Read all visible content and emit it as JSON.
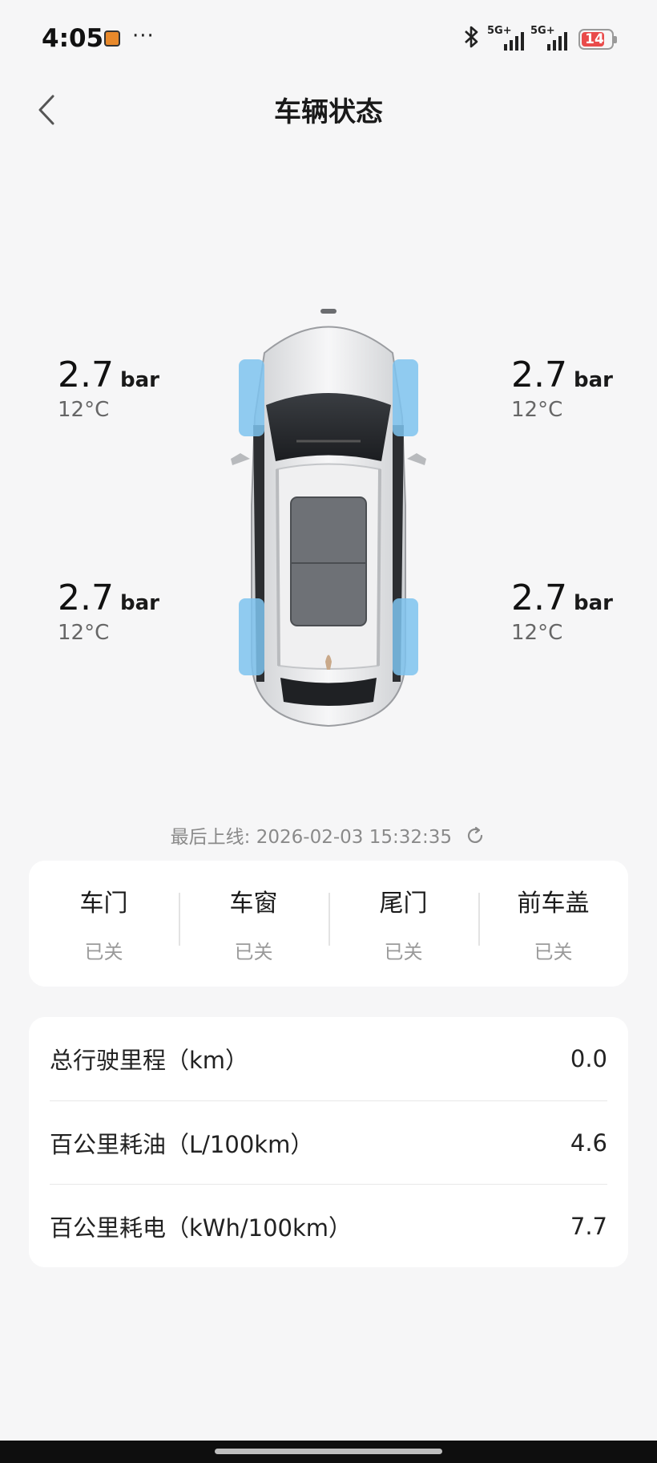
{
  "status_bar": {
    "time": "4:05",
    "dots": "···",
    "signal1": "5G+",
    "signal2": "5G+",
    "battery": "14",
    "icons": [
      "app-notification-icon",
      "bluetooth-icon",
      "signal-icon",
      "battery-icon"
    ]
  },
  "header": {
    "title": "车辆状态",
    "back_icon": "chevron-left-icon"
  },
  "tires": {
    "front_left": {
      "pressure": "2.7",
      "unit": "bar",
      "temp": "12°C"
    },
    "front_right": {
      "pressure": "2.7",
      "unit": "bar",
      "temp": "12°C"
    },
    "rear_left": {
      "pressure": "2.7",
      "unit": "bar",
      "temp": "12°C"
    },
    "rear_right": {
      "pressure": "2.7",
      "unit": "bar",
      "temp": "12°C"
    }
  },
  "last_online": "最后上线: 2026-02-03 15:32:35",
  "closures": [
    {
      "name": "车门",
      "status": "已关"
    },
    {
      "name": "车窗",
      "status": "已关"
    },
    {
      "name": "尾门",
      "status": "已关"
    },
    {
      "name": "前车盖",
      "status": "已关"
    }
  ],
  "stats": [
    {
      "label": "总行驶里程（km）",
      "value": "0.0"
    },
    {
      "label": "百公里耗油（L/100km）",
      "value": "4.6"
    },
    {
      "label": "百公里耗电（kWh/100km）",
      "value": "7.7"
    }
  ],
  "colors": {
    "background": "#f6f6f7",
    "card": "#ffffff",
    "tire_highlight": "#7ec3ee",
    "battery_low": "#e94b4b"
  }
}
